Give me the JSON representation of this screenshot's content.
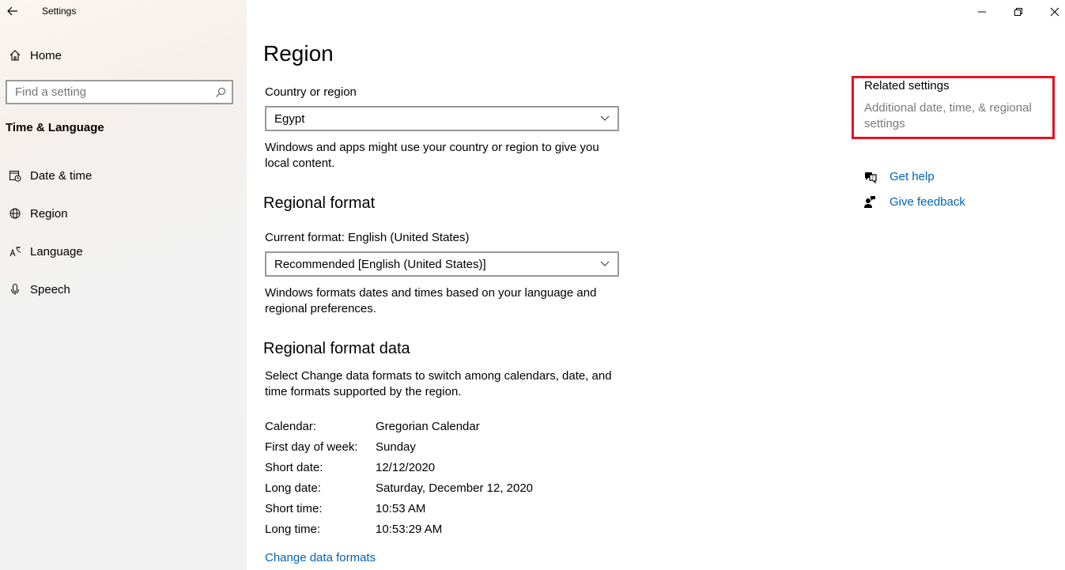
{
  "window": {
    "title": "Settings",
    "controls": [
      "minimize",
      "restore",
      "close"
    ]
  },
  "sidebar": {
    "home_label": "Home",
    "search_placeholder": "Find a setting",
    "section_title": "Time & Language",
    "items": [
      {
        "label": "Date & time",
        "icon": "date-time-icon"
      },
      {
        "label": "Region",
        "icon": "region-globe-icon"
      },
      {
        "label": "Language",
        "icon": "language-icon"
      },
      {
        "label": "Speech",
        "icon": "microphone-icon"
      }
    ]
  },
  "main": {
    "title": "Region",
    "country": {
      "label": "Country or region",
      "value": "Egypt",
      "description": "Windows and apps might use your country or region to give you local content."
    },
    "regional_format": {
      "heading": "Regional format",
      "current_label": "Current format: English (United States)",
      "value": "Recommended [English (United States)]",
      "description": "Windows formats dates and times based on your language and regional preferences."
    },
    "format_data": {
      "heading": "Regional format data",
      "description": "Select Change data formats to switch among calendars, date, and time formats supported by the region.",
      "rows": [
        {
          "label": "Calendar:",
          "value": "Gregorian Calendar"
        },
        {
          "label": "First day of week:",
          "value": "Sunday"
        },
        {
          "label": "Short date:",
          "value": "12/12/2020"
        },
        {
          "label": "Long date:",
          "value": "Saturday, December 12, 2020"
        },
        {
          "label": "Short time:",
          "value": "10:53 AM"
        },
        {
          "label": "Long time:",
          "value": "10:53:29 AM"
        }
      ],
      "change_link": "Change data formats"
    }
  },
  "related": {
    "title": "Related settings",
    "link": "Additional date, time, & regional settings",
    "get_help": "Get help",
    "give_feedback": "Give feedback"
  },
  "colors": {
    "accent_link": "#0063b1",
    "highlight_box": "#e81123"
  }
}
